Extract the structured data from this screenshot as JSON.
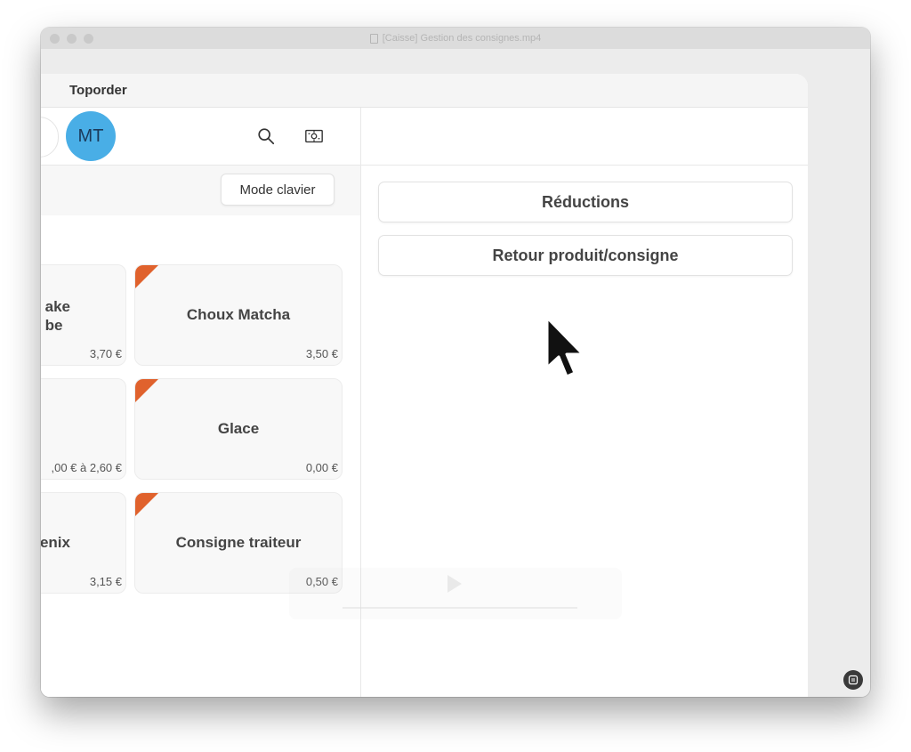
{
  "player": {
    "window_title": "[Caisse] Gestion des consignes.mp4"
  },
  "app": {
    "title": "Toporder",
    "avatar_initials": "MT",
    "mode_button_label": "Mode clavier"
  },
  "products": [
    {
      "name_line1": "ake",
      "name_line2": "be",
      "price": "3,70 €",
      "flag": false
    },
    {
      "name": "Choux Matcha",
      "price": "3,50 €",
      "flag": true
    },
    {
      "name": "",
      "price": ",00 € à 2,60 €",
      "flag": false
    },
    {
      "name": "Glace",
      "price": "0,00 €",
      "flag": true
    },
    {
      "name": "enix",
      "price": "3,15 €",
      "flag": false
    },
    {
      "name": "Consigne traiteur",
      "price": "0,50 €",
      "flag": true
    }
  ],
  "actions": {
    "reductions_label": "Réductions",
    "return_label": "Retour produit/consigne"
  },
  "colors": {
    "avatar_bg": "#49aee6",
    "flag": "#e0622d"
  },
  "icons": {
    "search": "search-icon",
    "cash": "cash-register-icon",
    "cursor": "mouse-cursor-icon"
  }
}
